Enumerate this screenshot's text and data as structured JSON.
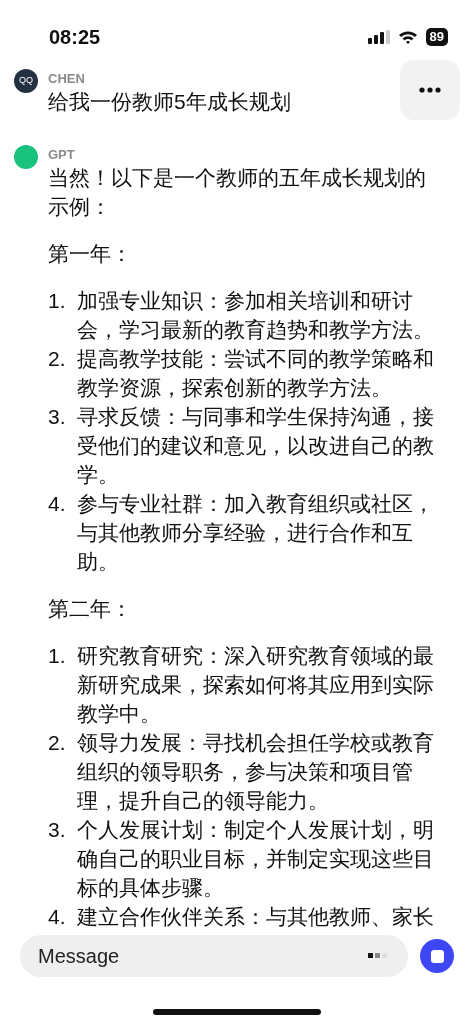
{
  "status_bar": {
    "time": "08:25",
    "battery": "89"
  },
  "user_message": {
    "avatar": "QQ",
    "name": "CHEN",
    "text": "给我一份教师5年成长规划"
  },
  "assistant_message": {
    "name": "GPT",
    "blocks": [
      {
        "kind": "paragraph",
        "text": "当然！以下是一个教师的五年成长规划的示例："
      },
      {
        "kind": "paragraph",
        "text": "第一年："
      },
      {
        "kind": "list",
        "items": [
          {
            "number": "1.",
            "text": "加强专业知识：参加相关培训和研讨会，学习最新的教育趋势和教学方法。"
          },
          {
            "number": "2.",
            "text": "提高教学技能：尝试不同的教学策略和教学资源，探索创新的教学方法。"
          },
          {
            "number": "3.",
            "text": "寻求反馈：与同事和学生保持沟通，接受他们的建议和意见，以改进自己的教学。"
          },
          {
            "number": "4.",
            "text": "参与专业社群：加入教育组织或社区，与其他教师分享经验，进行合作和互助。"
          }
        ]
      },
      {
        "kind": "paragraph",
        "text": "第二年："
      },
      {
        "kind": "list",
        "items": [
          {
            "number": "1.",
            "text": "研究教育研究：深入研究教育领域的最新研究成果，探索如何将其应用到实际教学中。"
          },
          {
            "number": "2.",
            "text": "领导力发展：寻找机会担任学校或教育组织的领导职务，参与决策和项目管理，提升自己的领导能力。"
          },
          {
            "number": "3.",
            "text": "个人发展计划：制定个人发展计划，明确自己的职业目标，并制定实现这些目标的具体步骤。"
          },
          {
            "number": "4.",
            "text": "建立合作伙伴关系：与其他教师、家长"
          }
        ]
      }
    ]
  },
  "composer": {
    "placeholder": "Message"
  }
}
